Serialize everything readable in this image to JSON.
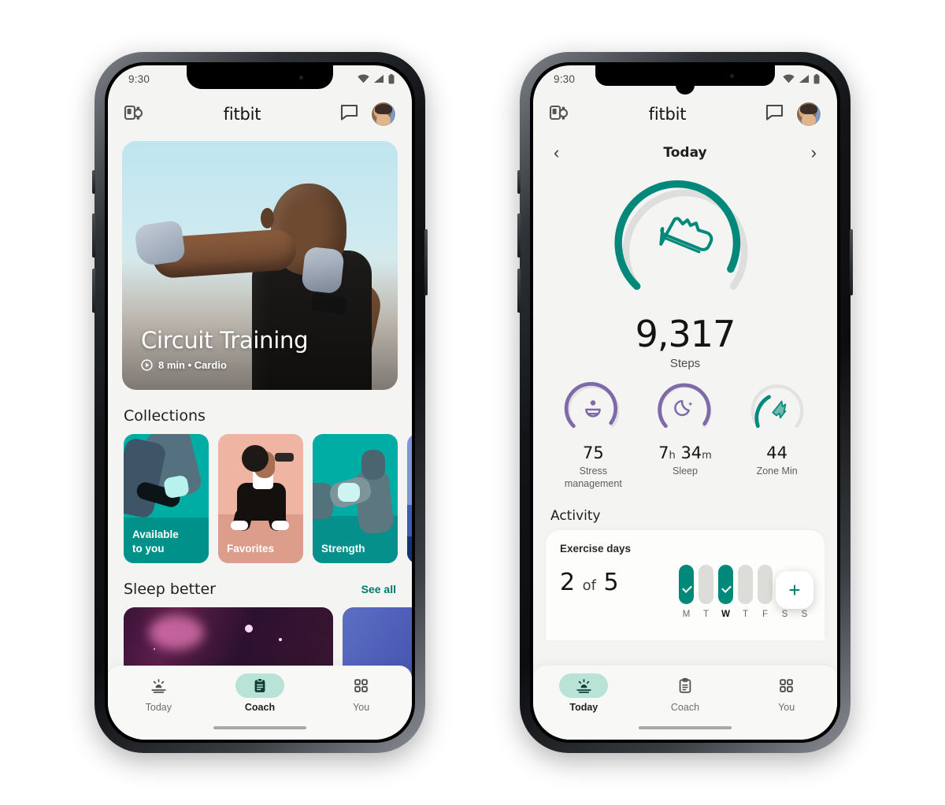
{
  "theme": {
    "teal": "#00897b",
    "teal_bright": "#00ada4",
    "teal_pill": "#b9e3d6",
    "purple": "#7e6aa8",
    "screen_bg": "#f4f4f2",
    "salmon": "#f0b5a2",
    "blue": "#7f94e0"
  },
  "phone_left": {
    "status_bar": {
      "time": "9:30",
      "icons": [
        "wifi-icon",
        "signal-icon",
        "battery-icon"
      ]
    },
    "app_bar": {
      "device_icon": "device-sync-icon",
      "brand": "fitbit",
      "message_icon": "chat-bubble-icon",
      "avatar": "profile-avatar"
    },
    "hero": {
      "title": "Circuit Training",
      "play_icon": "play-circle-icon",
      "meta": "8 min • Cardio"
    },
    "collections": {
      "heading": "Collections",
      "cards": [
        {
          "label": "Available\nto you",
          "color": "#00ada4",
          "art": "running-shoes-illustration"
        },
        {
          "label": "Favorites",
          "color": "#f0b5a2",
          "art": "dumbbell-squat-illustration"
        },
        {
          "label": "Strength",
          "color": "#00ada4",
          "art": "seated-stretch-illustration"
        },
        {
          "label": "",
          "color": "#7f94e0",
          "art": "blue-illustration"
        }
      ]
    },
    "sleep": {
      "heading": "Sleep better",
      "see_all": "See all"
    },
    "nav": {
      "items": [
        {
          "label": "Today",
          "icon": "sunrise-icon",
          "active": false
        },
        {
          "label": "Coach",
          "icon": "clipboard-icon",
          "active": true
        },
        {
          "label": "You",
          "icon": "grid-icon",
          "active": false
        }
      ]
    }
  },
  "phone_right": {
    "status_bar": {
      "time": "9:30",
      "icons": [
        "wifi-icon",
        "signal-icon",
        "battery-icon"
      ]
    },
    "app_bar": {
      "device_icon": "device-sync-icon",
      "brand": "fitbit",
      "message_icon": "chat-bubble-icon",
      "avatar": "profile-avatar"
    },
    "date_nav": {
      "prev_icon": "chevron-left-icon",
      "label": "Today",
      "next_icon": "chevron-right-icon"
    },
    "steps": {
      "value": "9,317",
      "unit": "Steps",
      "icon": "shoe-icon",
      "progress_percent": 93
    },
    "metrics": [
      {
        "icon": "stress-icon",
        "value": "75",
        "unit": "",
        "label": "Stress\nmanagement",
        "color": "#7e6aa8",
        "progress_percent": 72
      },
      {
        "icon": "moon-icon",
        "value": "7",
        "unit_1": "h",
        "value_2": "34",
        "unit_2": "m",
        "label": "Sleep",
        "color": "#7e6aa8",
        "progress_percent": 76
      },
      {
        "icon": "zone-minutes-icon",
        "value": "44",
        "unit": "",
        "label": "Zone Min",
        "color": "#00897b",
        "progress_percent": 36
      }
    ],
    "activity": {
      "heading": "Activity",
      "card_title": "Exercise days",
      "count": "2",
      "of": "of",
      "goal": "5",
      "add_icon": "plus-icon",
      "days": [
        {
          "letter": "M",
          "done": true,
          "today": false
        },
        {
          "letter": "T",
          "done": false,
          "today": false
        },
        {
          "letter": "W",
          "done": true,
          "today": true
        },
        {
          "letter": "T",
          "done": false,
          "today": false
        },
        {
          "letter": "F",
          "done": false,
          "today": false
        },
        {
          "letter": "S",
          "done": false,
          "today": false
        },
        {
          "letter": "S",
          "done": false,
          "today": false
        }
      ]
    },
    "nav": {
      "items": [
        {
          "label": "Today",
          "icon": "sunrise-icon",
          "active": true
        },
        {
          "label": "Coach",
          "icon": "clipboard-icon",
          "active": false
        },
        {
          "label": "You",
          "icon": "grid-icon",
          "active": false
        }
      ]
    }
  }
}
